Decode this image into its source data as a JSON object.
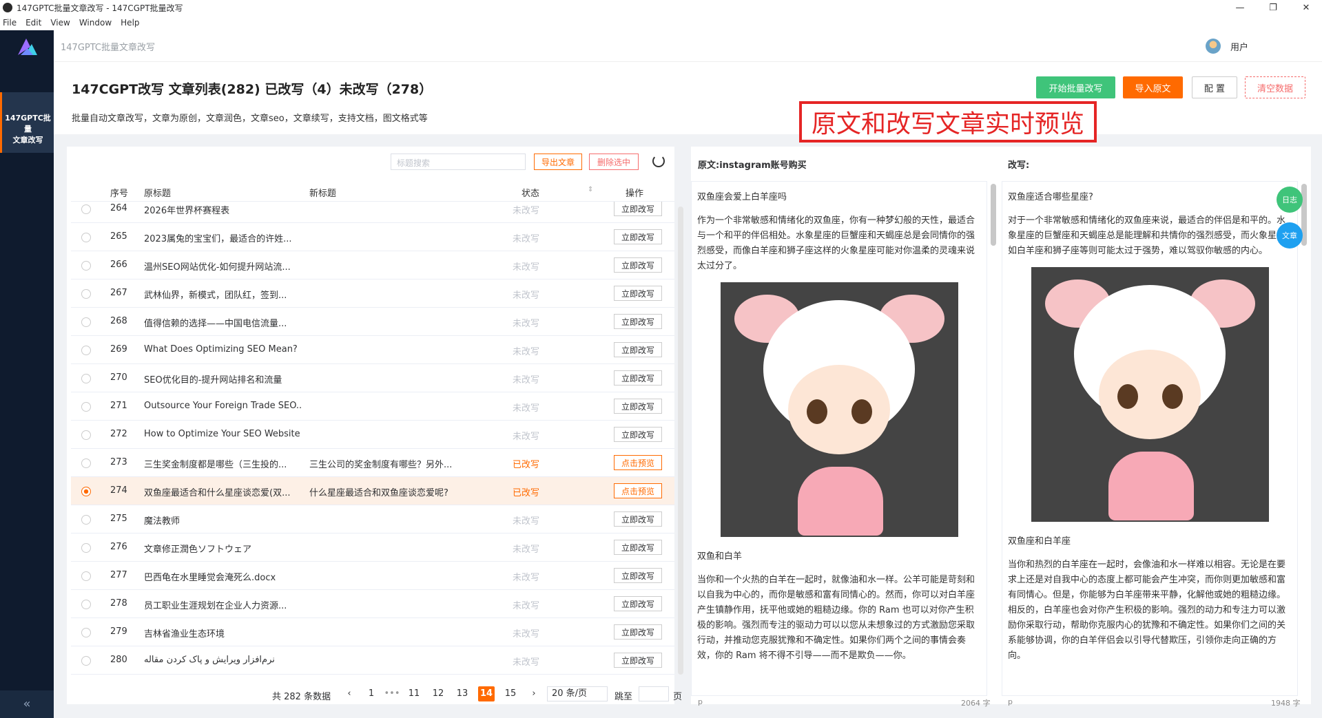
{
  "window": {
    "title": "147GPTC批量文章改写 - 147CGPT批量改写"
  },
  "menu": [
    "File",
    "Edit",
    "View",
    "Window",
    "Help"
  ],
  "sidebar": {
    "item_line1": "147GPTC批量",
    "item_line2": "文章改写",
    "collapse": "«"
  },
  "topbar": {
    "brand": "147GPTC批量文章改写",
    "user": "用户"
  },
  "header": {
    "title": "147CGPT改写 文章列表(282) 已改写（4）未改写（278）",
    "subtitle": "批量自动文章改写，文章为原创，文章润色，文章seo，文章续写，支持文档，图文格式等",
    "start_btn": "开始批量改写",
    "import_btn": "导入原文",
    "config_btn": "配 置",
    "clear_btn": "清空数据"
  },
  "annotation": "原文和改写文章实时预览",
  "list": {
    "search_placeholder": "标题搜索",
    "export_btn": "导出文章",
    "delete_btn": "删除选中",
    "columns": {
      "num": "序号",
      "orig": "原标题",
      "new": "新标题",
      "status": "状态",
      "action": "操作"
    },
    "rows": [
      {
        "num": "264",
        "orig": "2026年世界杯赛程表",
        "new": "",
        "status": "未改写",
        "action": "立即改写"
      },
      {
        "num": "265",
        "orig": "2023属兔的宝宝们，最适合的许姓...",
        "new": "",
        "status": "未改写",
        "action": "立即改写"
      },
      {
        "num": "266",
        "orig": "温州SEO网站优化-如何提升网站流...",
        "new": "",
        "status": "未改写",
        "action": "立即改写"
      },
      {
        "num": "267",
        "orig": "武林仙界，新模式，团队红，签到...",
        "new": "",
        "status": "未改写",
        "action": "立即改写"
      },
      {
        "num": "268",
        "orig": "值得信赖的选择——中国电信流量...",
        "new": "",
        "status": "未改写",
        "action": "立即改写"
      },
      {
        "num": "269",
        "orig": "What Does Optimizing SEO Mean?",
        "new": "",
        "status": "未改写",
        "action": "立即改写"
      },
      {
        "num": "270",
        "orig": "SEO优化目的-提升网站排名和流量",
        "new": "",
        "status": "未改写",
        "action": "立即改写"
      },
      {
        "num": "271",
        "orig": "Outsource Your Foreign Trade SEO...",
        "new": "",
        "status": "未改写",
        "action": "立即改写"
      },
      {
        "num": "272",
        "orig": "How to Optimize Your SEO Website",
        "new": "",
        "status": "未改写",
        "action": "立即改写"
      },
      {
        "num": "273",
        "orig": "三生奖金制度都是哪些（三生投的...",
        "new": "三生公司的奖金制度有哪些？另外...",
        "status": "已改写",
        "action": "点击预览"
      },
      {
        "num": "274",
        "orig": "双鱼座最适合和什么星座谈恋爱(双...",
        "new": "什么星座最适合和双鱼座谈恋爱呢?",
        "status": "已改写",
        "action": "点击预览"
      },
      {
        "num": "275",
        "orig": "魔法教师",
        "new": "",
        "status": "未改写",
        "action": "立即改写"
      },
      {
        "num": "276",
        "orig": "文章修正潤色ソフトウェア",
        "new": "",
        "status": "未改写",
        "action": "立即改写"
      },
      {
        "num": "277",
        "orig": "巴西龟在水里睡觉会淹死么.docx",
        "new": "",
        "status": "未改写",
        "action": "立即改写"
      },
      {
        "num": "278",
        "orig": "员工职业生涯规划在企业人力资源...",
        "new": "",
        "status": "未改写",
        "action": "立即改写"
      },
      {
        "num": "279",
        "orig": "吉林省渔业生态环境",
        "new": "",
        "status": "未改写",
        "action": "立即改写"
      },
      {
        "num": "280",
        "orig": "نرم‌افزار ویرایش و پاک کردن مقاله",
        "new": "",
        "status": "未改写",
        "action": "立即改写"
      }
    ],
    "pager": {
      "total": "共 282 条数据",
      "prev": "‹",
      "next": "›",
      "pages": [
        "1",
        "•••",
        "11",
        "12",
        "13",
        "14",
        "15"
      ],
      "current": "14",
      "size": "20 条/页",
      "jump": "跳至",
      "page_unit": "页"
    }
  },
  "preview": {
    "orig_header": "原文:instagram账号购买",
    "new_header": "改写:",
    "orig": {
      "title": "双鱼座会爱上白羊座吗",
      "p1": "作为一个非常敏感和情绪化的双鱼座，你有一种梦幻般的天性，最适合与一个和平的伴侣相处。水象星座的巨蟹座和天蝎座总是会同情你的强烈感受，而像白羊座和狮子座这样的火象星座可能对你温柔的灵魂来说太过分了。",
      "sub": "双鱼和白羊",
      "p2": "当你和一个火热的白羊在一起时，就像油和水一样。公羊可能是苛刻和以自我为中心的，而你是敏感和富有同情心的。然而，你可以对白羊座产生镇静作用，抚平他或她的粗糙边缘。你的 Ram 也可以对你产生积极的影响。强烈而专注的驱动力可以以您从未想象过的方式激励您采取行动，并推动您克服犹豫和不确定性。如果你们两个之间的事情会奏效，你的 Ram 将不得不引导——而不是欺负——你。",
      "footer_left": "p",
      "count": "2064 字"
    },
    "new": {
      "title": "双鱼座适合哪些星座?",
      "p1": "对于一个非常敏感和情绪化的双鱼座来说，最适合的伴侣是和平的。水象星座的巨蟹座和天蝎座总是能理解和共情你的强烈感受，而火象星座如白羊座和狮子座等则可能太过于强势，难以驾驭你敏感的内心。",
      "sub": "双鱼座和白羊座",
      "p2": "当你和热烈的白羊座在一起时，会像油和水一样难以相容。无论是在要求上还是对自我中心的态度上都可能会产生冲突，而你则更加敏感和富有同情心。但是，你能够为白羊座带来平静，化解他或她的粗糙边缘。相反的，白羊座也会对你产生积极的影响。强烈的动力和专注力可以激励你采取行动，帮助你克服内心的犹豫和不确定性。如果你们之间的关系能够协调，你的白羊伴侣会以引导代替欺压，引领你走向正确的方向。",
      "footer_left": "p",
      "count": "1948 字"
    },
    "float1": "日志",
    "float2": "文章"
  },
  "colors": {
    "accent": "#ff6a00",
    "green": "#3fc47a",
    "danger": "#e52525",
    "sidebar": "#0f1b2e"
  }
}
